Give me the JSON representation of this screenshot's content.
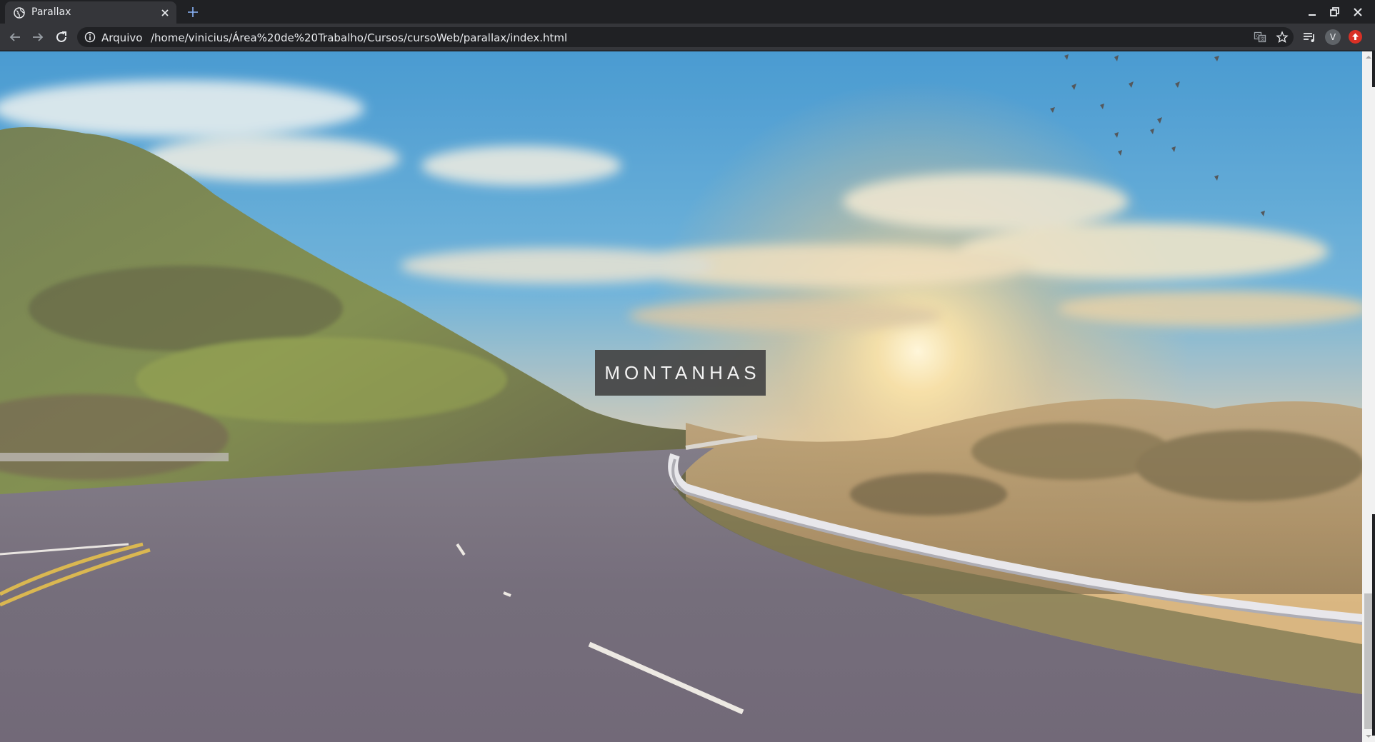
{
  "browser": {
    "tab": {
      "title": "Parallax",
      "favicon": "globe-icon",
      "close_icon": "close-icon"
    },
    "new_tab_icon": "plus-icon",
    "window_controls": [
      "minimize-icon",
      "restore-icon",
      "close-icon"
    ],
    "toolbar": {
      "back_icon": "arrow-left-icon",
      "forward_icon": "arrow-right-icon",
      "reload_icon": "reload-icon",
      "info_icon": "info-icon",
      "origin_chip": "Arquivo",
      "url": "/home/vinicius/Área%20de%20Trabalho/Cursos/cursoWeb/parallax/index.html",
      "translate_icon": "translate-icon",
      "bookmark_icon": "star-icon",
      "media_icon": "media-queue-icon",
      "profile_initial": "V",
      "extension_icon": "extension-icon"
    }
  },
  "page": {
    "hero_title": "MONTANHAS",
    "background": "mountain-road-sunset-photo"
  },
  "colors": {
    "chrome_dark": "#202124",
    "chrome_toolbar": "#35363a",
    "title_box_bg": "#444444",
    "title_text": "#f2f2f2",
    "sky": "#4a9fd0",
    "sun": "#ffd98a"
  }
}
